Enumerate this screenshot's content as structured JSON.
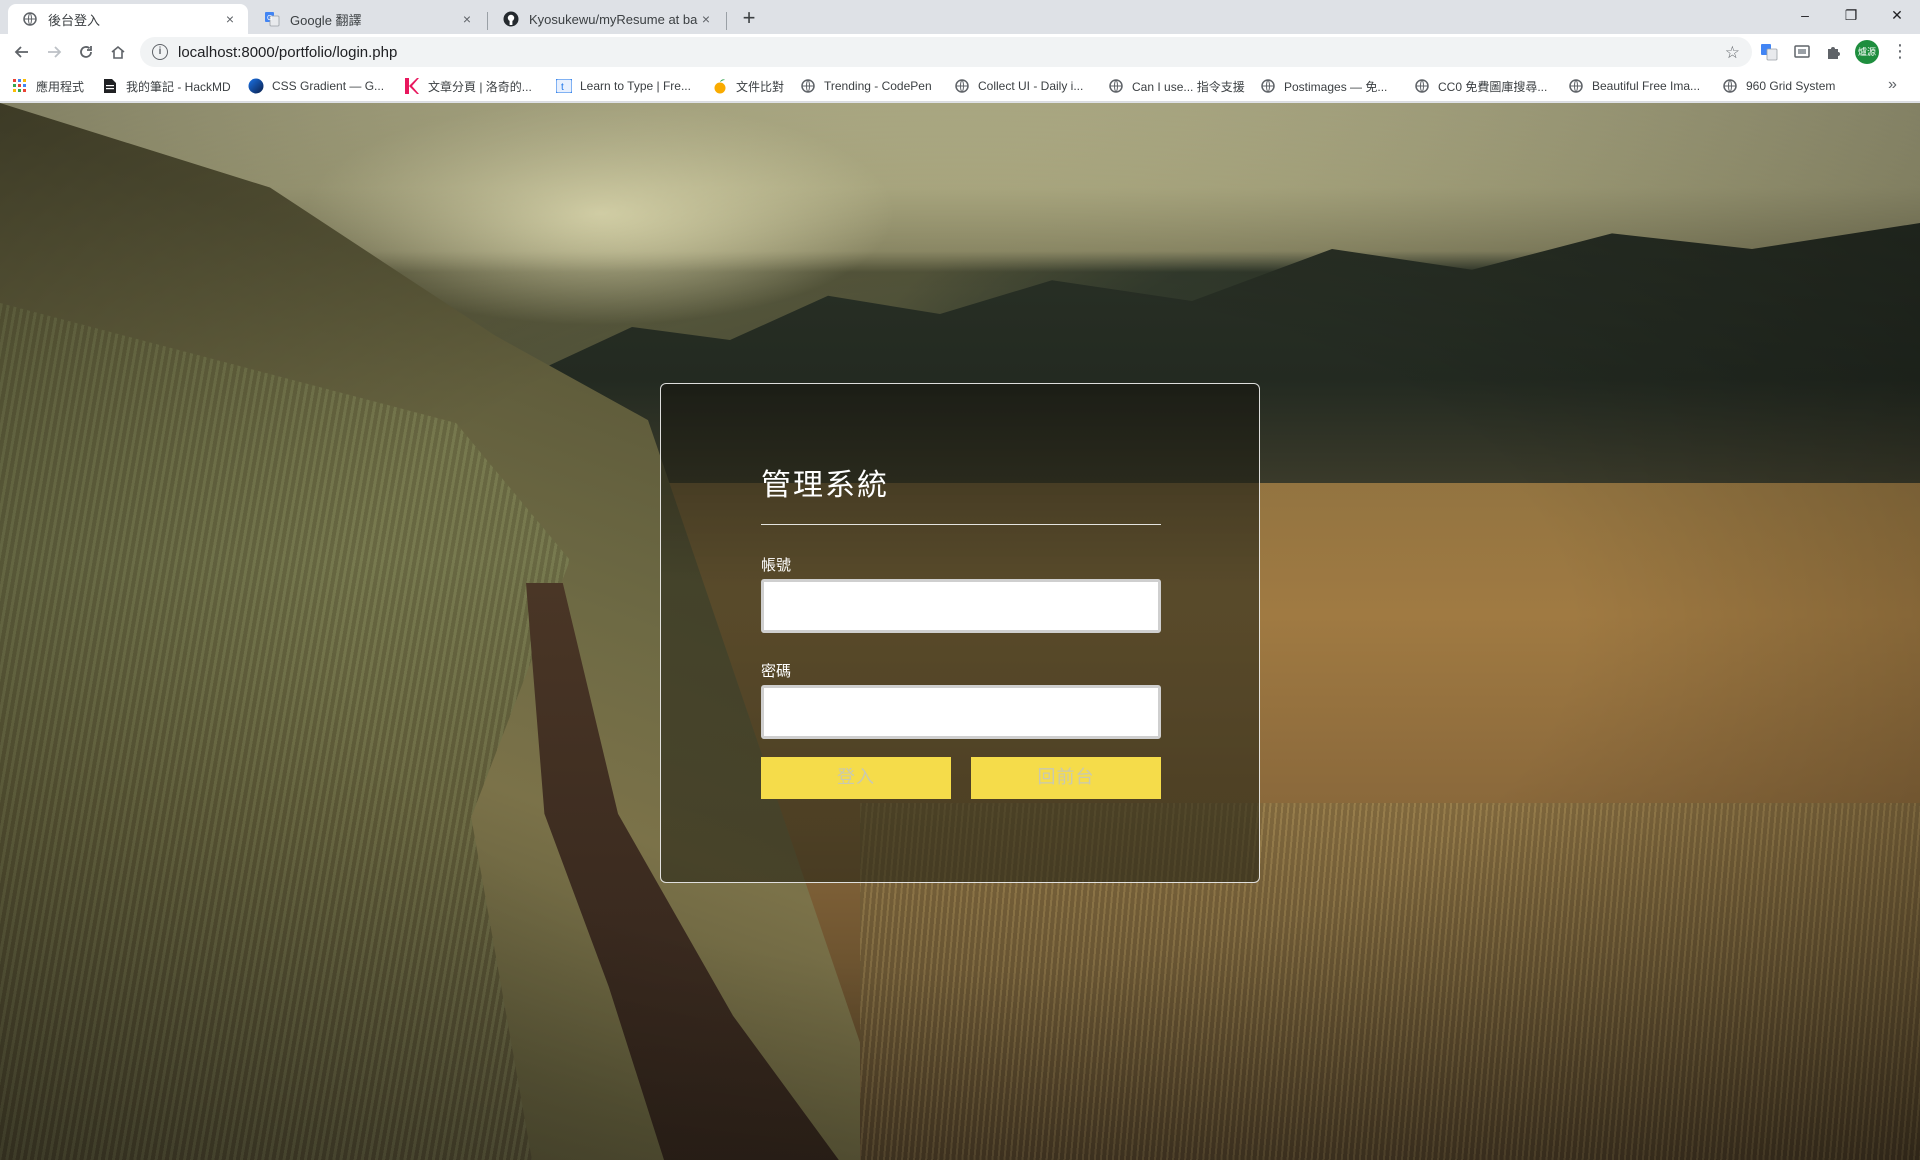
{
  "browser": {
    "tabs": [
      {
        "title": "後台登入",
        "icon": "globe-icon",
        "active": true
      },
      {
        "title": "Google 翻譯",
        "icon": "google-translate-icon",
        "active": false
      },
      {
        "title": "Kyosukewu/myResume at back",
        "icon": "github-icon",
        "active": false
      }
    ],
    "close_glyph": "×",
    "new_tab_glyph": "+",
    "window_controls": {
      "minimize": "–",
      "restore": "❐",
      "close": "✕"
    },
    "url": "localhost:8000/portfolio/login.php",
    "info_glyph": "i",
    "star_glyph": "☆",
    "menu_glyph": "⋮",
    "avatar_text": "爐源"
  },
  "bookmarks": [
    {
      "label": "應用程式",
      "icon": "apps-grid-icon"
    },
    {
      "label": "我的筆記 - HackMD",
      "icon": "document-icon"
    },
    {
      "label": "CSS Gradient — G...",
      "icon": "css-gradient-icon"
    },
    {
      "label": "文章分頁 | 洛奇的...",
      "icon": "k-logo-icon"
    },
    {
      "label": "Learn to Type | Fre...",
      "icon": "keyboard-icon"
    },
    {
      "label": "文件比對",
      "icon": "fruit-icon"
    },
    {
      "label": "Trending - CodePen",
      "icon": "globe-icon"
    },
    {
      "label": "Collect UI - Daily i...",
      "icon": "globe-icon"
    },
    {
      "label": "Can I use... 指令支援",
      "icon": "globe-icon"
    },
    {
      "label": "Postimages — 免...",
      "icon": "globe-icon"
    },
    {
      "label": "CC0 免費圖庫搜尋...",
      "icon": "globe-icon"
    },
    {
      "label": "Beautiful Free Ima...",
      "icon": "globe-icon"
    },
    {
      "label": "960 Grid System",
      "icon": "globe-icon"
    }
  ],
  "bookmarks_more": "»",
  "login": {
    "title": "管理系統",
    "username_label": "帳號",
    "username_value": "",
    "password_label": "密碼",
    "password_value": "",
    "login_button": "登入",
    "back_button": "回前台",
    "accent_color": "#f5dc4a"
  }
}
